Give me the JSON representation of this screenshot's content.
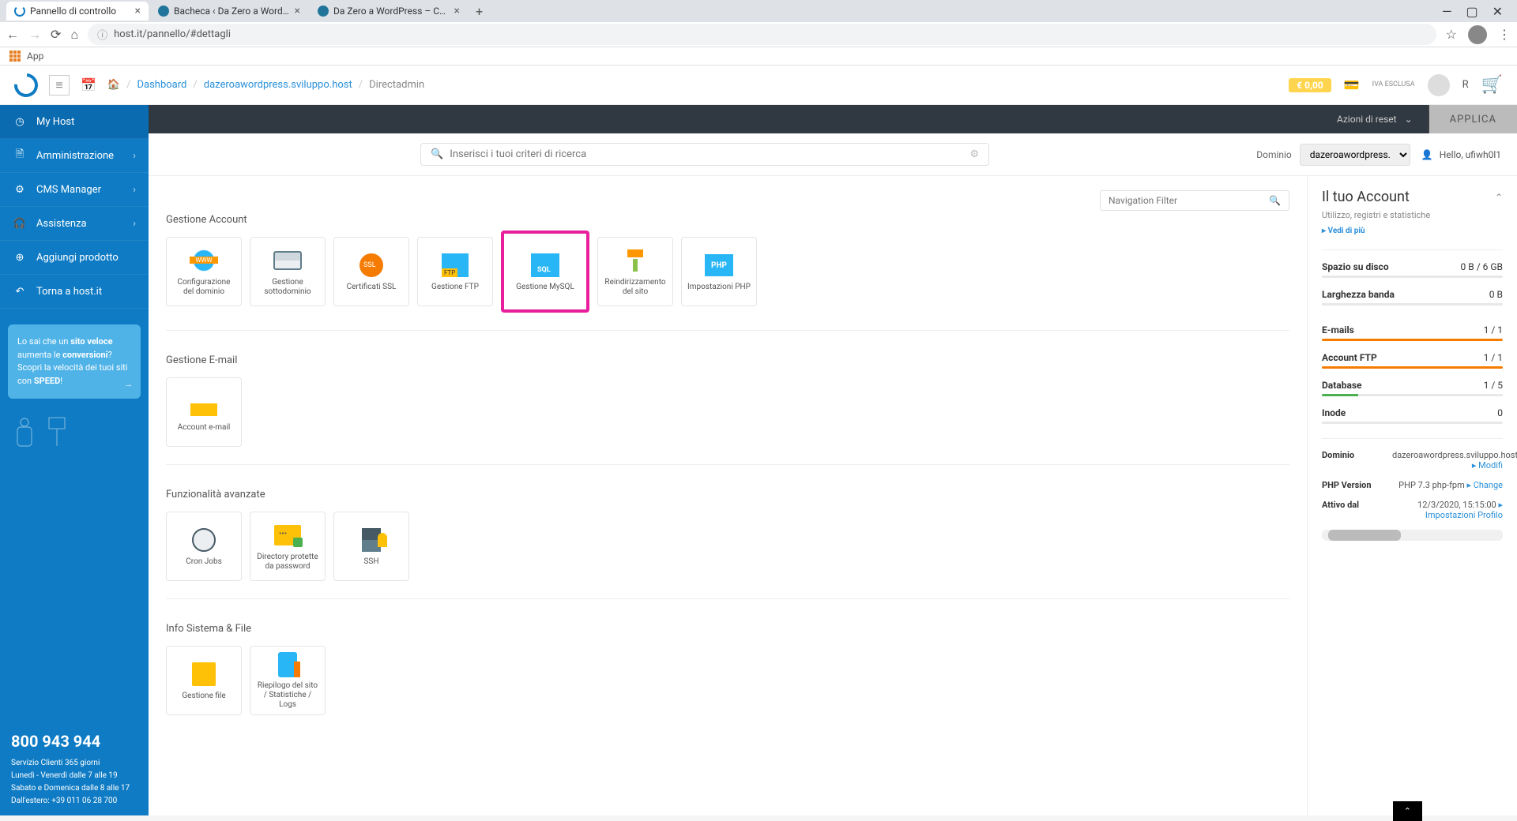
{
  "browser": {
    "tabs": [
      {
        "title": "Pannello di controllo",
        "active": true
      },
      {
        "title": "Bacheca ‹ Da Zero a Wordpress –",
        "active": false
      },
      {
        "title": "Da Zero a WordPress – Corso da",
        "active": false
      }
    ],
    "url": "host.it/pannello/#dettagli",
    "bookmark_app": "App"
  },
  "header": {
    "breadcrumb": [
      "Dashboard",
      "dazeroawordpress.sviluppo.host",
      "Directadmin"
    ],
    "price": "€ 0,00",
    "vat": "IVA ESCLUSA",
    "user_letter": "R"
  },
  "sidebar": {
    "items": [
      {
        "label": "My Host",
        "chevron": false,
        "active": true
      },
      {
        "label": "Amministrazione",
        "chevron": true
      },
      {
        "label": "CMS Manager",
        "chevron": true
      },
      {
        "label": "Assistenza",
        "chevron": true
      },
      {
        "label": "Aggiungi prodotto",
        "chevron": false
      },
      {
        "label": "Torna a host.it",
        "chevron": false
      }
    ],
    "promo": {
      "l1": "Lo sai che un ",
      "b1": "sito veloce",
      "l2": " aumenta le ",
      "b2": "conversioni",
      "l3": "? Scopri la velocità dei tuoi siti con ",
      "b3": "SPEED",
      "l4": "!"
    },
    "support": {
      "phone": "800 943 944",
      "line1": "Servizio Clienti 365 giorni",
      "line2": "Lunedì - Venerdì dalle 7 alle 19",
      "line3": "Sabato e Domenica dalle 8 alle 17",
      "line4": "Dall'estero: +39 011 06 28 700"
    }
  },
  "topbar": {
    "reset": "Azioni di reset",
    "apply": "APPLICA"
  },
  "search": {
    "placeholder": "Inserisci i tuoi criteri di ricerca",
    "domain_label": "Dominio",
    "domain_value": "dazeroawordpress.s...",
    "hello": "Hello, ufiwh0l1",
    "nav_filter_placeholder": "Navigation Filter"
  },
  "sections": {
    "account": {
      "title": "Gestione Account",
      "tiles": [
        {
          "label": "Configurazione del dominio",
          "icon": "www"
        },
        {
          "label": "Gestione sottodominio",
          "icon": "sub"
        },
        {
          "label": "Certificati SSL",
          "icon": "ssl"
        },
        {
          "label": "Gestione FTP",
          "icon": "ftp"
        },
        {
          "label": "Gestione MySQL",
          "icon": "sql",
          "highlight": true
        },
        {
          "label": "Reindirizzamento del sito",
          "icon": "redir"
        },
        {
          "label": "Impostazioni PHP",
          "icon": "php",
          "text": "PHP"
        }
      ]
    },
    "email": {
      "title": "Gestione E-mail",
      "tiles": [
        {
          "label": "Account e-mail",
          "icon": "mail"
        }
      ]
    },
    "advanced": {
      "title": "Funzionalità avanzate",
      "tiles": [
        {
          "label": "Cron Jobs",
          "icon": "cron"
        },
        {
          "label": "Directory protette da password",
          "icon": "folder-lock"
        },
        {
          "label": "SSH",
          "icon": "ssh"
        }
      ]
    },
    "system": {
      "title": "Info Sistema & File",
      "tiles": [
        {
          "label": "Gestione file",
          "icon": "file"
        },
        {
          "label": "Riepilogo del sito / Statistiche / Logs",
          "icon": "stats"
        }
      ]
    }
  },
  "account_panel": {
    "title": "Il tuo Account",
    "subtitle": "Utilizzo, registri e statistiche",
    "more": "▸ Vedi di più",
    "stats": [
      {
        "label": "Spazio su disco",
        "value": "0 B / 6 GB",
        "pct": 0,
        "color": "gray"
      },
      {
        "label": "Larghezza banda",
        "value": "0 B",
        "pct": 0,
        "color": "gray"
      },
      {
        "label": "E-mails",
        "value": "1 / 1",
        "pct": 100,
        "color": "orange"
      },
      {
        "label": "Account FTP",
        "value": "1 / 1",
        "pct": 100,
        "color": "orange"
      },
      {
        "label": "Database",
        "value": "1 / 5",
        "pct": 20,
        "color": "green"
      },
      {
        "label": "Inode",
        "value": "0",
        "pct": 0,
        "color": "gray"
      }
    ],
    "info": [
      {
        "k": "Dominio",
        "v": "dazeroawordpress.sviluppo.host",
        "link": "Modifi"
      },
      {
        "k": "PHP Version",
        "v": "PHP 7.3 php-fpm",
        "link": "Change"
      },
      {
        "k": "Attivo dal",
        "v": "12/3/2020, 15:15:00",
        "link": "Impostazioni Profilo"
      }
    ]
  }
}
